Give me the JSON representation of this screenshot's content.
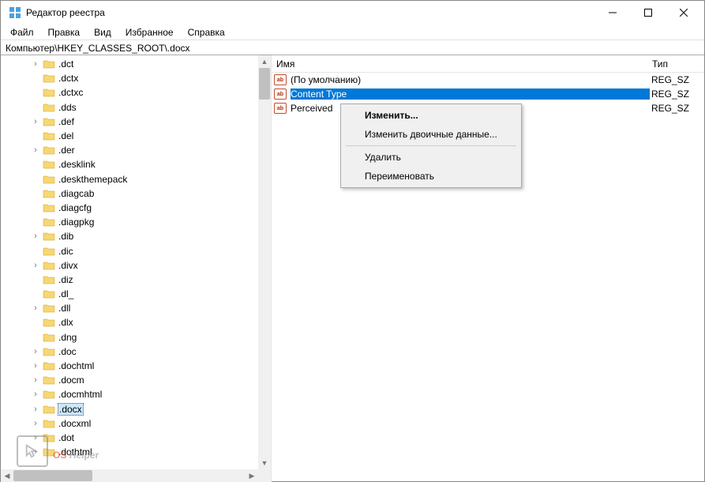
{
  "window": {
    "title": "Редактор реестра"
  },
  "menu": {
    "file": "Файл",
    "edit": "Правка",
    "view": "Вид",
    "favorites": "Избранное",
    "help": "Справка"
  },
  "address": "Компьютер\\HKEY_CLASSES_ROOT\\.docx",
  "tree": [
    {
      "expandable": true,
      "label": ".dct"
    },
    {
      "expandable": false,
      "label": ".dctx"
    },
    {
      "expandable": false,
      "label": ".dctxc"
    },
    {
      "expandable": false,
      "label": ".dds"
    },
    {
      "expandable": true,
      "label": ".def"
    },
    {
      "expandable": false,
      "label": ".del"
    },
    {
      "expandable": true,
      "label": ".der"
    },
    {
      "expandable": false,
      "label": ".desklink"
    },
    {
      "expandable": false,
      "label": ".deskthemepack"
    },
    {
      "expandable": false,
      "label": ".diagcab"
    },
    {
      "expandable": false,
      "label": ".diagcfg"
    },
    {
      "expandable": false,
      "label": ".diagpkg"
    },
    {
      "expandable": true,
      "label": ".dib"
    },
    {
      "expandable": false,
      "label": ".dic"
    },
    {
      "expandable": true,
      "label": ".divx"
    },
    {
      "expandable": false,
      "label": ".diz"
    },
    {
      "expandable": false,
      "label": ".dl_"
    },
    {
      "expandable": true,
      "label": ".dll"
    },
    {
      "expandable": false,
      "label": ".dlx"
    },
    {
      "expandable": false,
      "label": ".dng"
    },
    {
      "expandable": true,
      "label": ".doc"
    },
    {
      "expandable": true,
      "label": ".dochtml"
    },
    {
      "expandable": true,
      "label": ".docm"
    },
    {
      "expandable": true,
      "label": ".docmhtml"
    },
    {
      "expandable": true,
      "label": ".docx",
      "selected": true
    },
    {
      "expandable": true,
      "label": ".docxml"
    },
    {
      "expandable": true,
      "label": ".dot"
    },
    {
      "expandable": true,
      "label": ".dothtml"
    }
  ],
  "columns": {
    "name": "Имя",
    "type": "Тип"
  },
  "values": [
    {
      "icon": "ab",
      "name": "(По умолчанию)",
      "type": "REG_SZ",
      "selected": false
    },
    {
      "icon": "ab",
      "name": "Content Type",
      "type": "REG_SZ",
      "selected": true
    },
    {
      "icon": "ab",
      "name": "PerceivedType",
      "type": "REG_SZ",
      "selected": false,
      "trunc": "Perceived"
    }
  ],
  "context_menu": {
    "modify": "Изменить...",
    "modify_binary": "Изменить двоичные данные...",
    "delete": "Удалить",
    "rename": "Переименовать"
  },
  "watermark": {
    "os": "OS",
    "helper": " Helper"
  }
}
